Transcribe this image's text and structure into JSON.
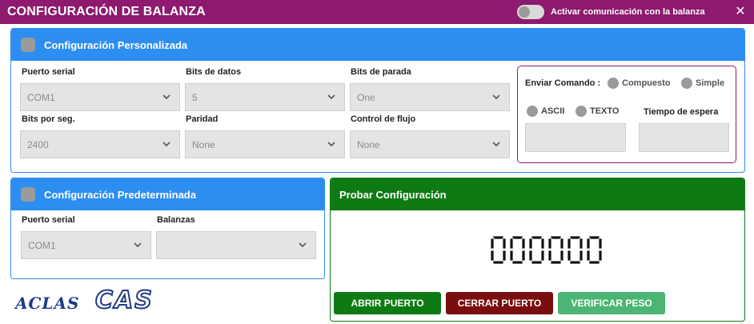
{
  "window": {
    "title": "CONFIGURACIÓN DE BALANZA",
    "toggle_label": "Activar comunicación con la balanza",
    "close_symbol": "✕"
  },
  "custom": {
    "title": "Configuración Personalizada",
    "fields": [
      {
        "label": "Puerto serial",
        "value": "COM1"
      },
      {
        "label": "Bits de datos",
        "value": "5"
      },
      {
        "label": "Bits de parada",
        "value": "One"
      },
      {
        "label": "Bits por seg.",
        "value": "2400"
      },
      {
        "label": "Paridad",
        "value": "None"
      },
      {
        "label": "Control de flujo",
        "value": "None"
      }
    ],
    "command": {
      "label": "Enviar Comando :",
      "options": [
        "Compuesto",
        "Simple",
        "ASCII",
        "TEXTO"
      ],
      "wait_label": "Tiempo de espera"
    }
  },
  "default": {
    "title": "Configuración Predeterminada",
    "fields": [
      {
        "label": "Puerto serial",
        "value": "COM1"
      },
      {
        "label": "Balanzas",
        "value": ""
      }
    ]
  },
  "test": {
    "title": "Probar Configuración",
    "display": "000000",
    "buttons": {
      "open": "ABRIR PUERTO",
      "close": "CERRAR PUERTO",
      "verify": "VERIFICAR PESO"
    }
  },
  "logos": {
    "aclas": "ACLAS",
    "cas": "CAS"
  },
  "colors": {
    "titlebar": "#8d1a6e",
    "blue": "#2d8ef2",
    "green": "#0e7a13",
    "btn_open": "#0e7a13",
    "btn_close": "#7a0d0d",
    "btn_verify": "#4cb574"
  },
  "icons": [
    "toggle-switch",
    "close-icon",
    "checkbox-icon",
    "chevron-down-icon",
    "radio-icon"
  ]
}
